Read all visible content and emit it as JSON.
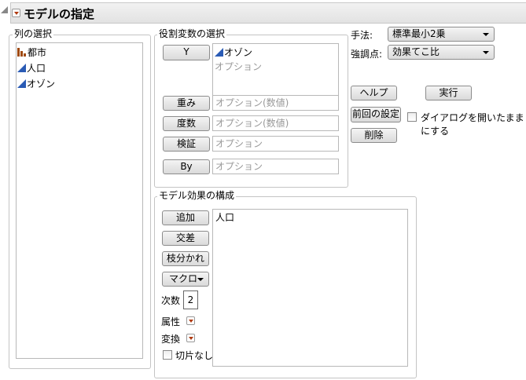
{
  "title": "モデルの指定",
  "columns": {
    "label": "列の選択",
    "items": [
      {
        "name": "都市",
        "type": "nominal"
      },
      {
        "name": "人口",
        "type": "continuous"
      },
      {
        "name": "オゾン",
        "type": "continuous"
      }
    ]
  },
  "roles": {
    "label": "役割変数の選択",
    "y": {
      "button": "Y",
      "value": "オゾン",
      "placeholder": "オプション"
    },
    "weight": {
      "button": "重み",
      "placeholder": "オプション(数値)"
    },
    "freq": {
      "button": "度数",
      "placeholder": "オプション(数値)"
    },
    "validation": {
      "button": "検証",
      "placeholder": "オプション"
    },
    "by": {
      "button": "By",
      "placeholder": "オプション"
    }
  },
  "method": {
    "label": "手法:",
    "value": "標準最小2乗"
  },
  "emphasis": {
    "label": "強調点:",
    "value": "効果てこ比"
  },
  "actions": {
    "help": "ヘルプ",
    "run": "実行",
    "recall": "前回の設定",
    "keep_open": "ダイアログを開いたままにする",
    "remove": "削除"
  },
  "effects": {
    "label": "モデル効果の構成",
    "add": "追加",
    "cross": "交差",
    "nest": "枝分かれ",
    "macros": "マクロ",
    "degree_label": "次数",
    "degree": "2",
    "attributes": "属性",
    "transform": "変換",
    "no_intercept": "切片なし",
    "items": [
      "人口"
    ]
  }
}
